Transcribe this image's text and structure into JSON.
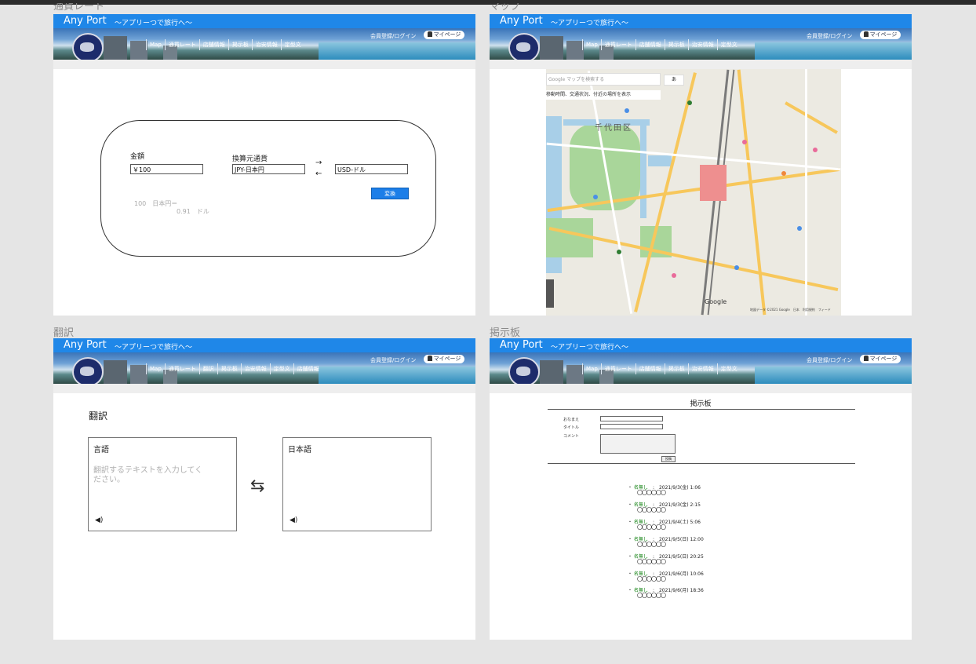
{
  "frames": {
    "currency": {
      "label": "通貨レート"
    },
    "map": {
      "label": "マップ"
    },
    "translate": {
      "label": "翻訳"
    },
    "board": {
      "label": "掲示板"
    }
  },
  "header": {
    "title": "Any Port",
    "subtitle": "〜アプリーつで旅行へ〜",
    "login": "会員登録/ログイン",
    "mypage": "マイページ"
  },
  "nav_a": [
    "Map",
    "通貨レート",
    "店舗情報",
    "掲示板",
    "治安情報",
    "定型文"
  ],
  "nav_b": [
    "Map",
    "通貨レート",
    "翻訳",
    "掲示板",
    "治安情報",
    "定型文",
    "店舗情報"
  ],
  "currency": {
    "amount_label": "金額",
    "amount_value": "￥100",
    "from_label": "換算元通貨",
    "from_value": "JPY-日本円",
    "to_value": "USD-ドル",
    "arrow_right": "→",
    "arrow_left": "←",
    "convert_button": "変換",
    "result_line1": "100　日本円＝",
    "result_line2": "0.91　ドル"
  },
  "map": {
    "search_placeholder": "Google マップを検索する",
    "hint": "移動時間、交通状況、付近の場所を表示",
    "lang": "あ",
    "area_name": "千代田区",
    "google": "Google",
    "credit": "地図データ ©2021 Google　日本　利用規約　フィード"
  },
  "translate": {
    "title": "翻訳",
    "source_lang": "言語",
    "source_placeholder": "翻訳するテキストを入力してください。",
    "target_lang": "日本語",
    "speaker": "◀)"
  },
  "board": {
    "title": "掲示板",
    "name_label": "おなまえ",
    "title_label": "タイトル",
    "comment_label": "コメント",
    "submit": "投稿",
    "posts": [
      {
        "name": "名無し",
        "date": "2021/9/3(金) 1:06",
        "body": "〇〇〇〇〇〇"
      },
      {
        "name": "名無し",
        "date": "2021/9/3(金) 2:15",
        "body": "〇〇〇〇〇〇"
      },
      {
        "name": "名無し",
        "date": "2021/9/4(土) 5:06",
        "body": "〇〇〇〇〇〇"
      },
      {
        "name": "名無し",
        "date": "2021/9/5(日) 12:00",
        "body": "〇〇〇〇〇〇"
      },
      {
        "name": "名無し",
        "date": "2021/9/5(日) 20:25",
        "body": "〇〇〇〇〇〇"
      },
      {
        "name": "名無し",
        "date": "2021/9/6(月) 10:06",
        "body": "〇〇〇〇〇〇"
      },
      {
        "name": "名無し",
        "date": "2021/9/6(月) 18:36",
        "body": "〇〇〇〇〇〇"
      }
    ]
  }
}
